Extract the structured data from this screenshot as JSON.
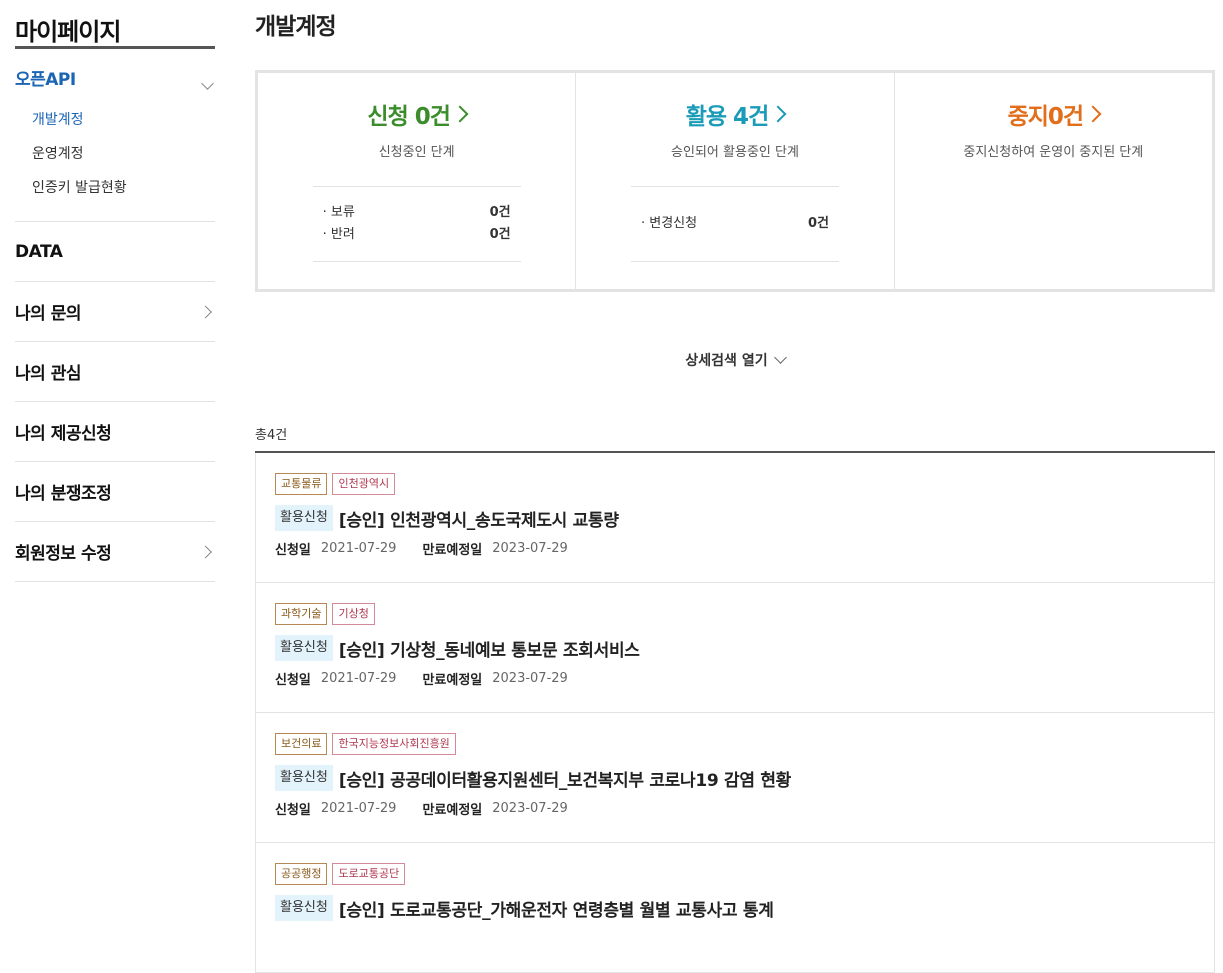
{
  "sidebar": {
    "title": "마이페이지",
    "open_menu": {
      "label": "오픈API",
      "sub_items": [
        "개발계정",
        "운영계정",
        "인증키 발급현황"
      ]
    },
    "items": [
      {
        "label": "DATA"
      },
      {
        "label": "나의 문의"
      },
      {
        "label": "나의 관심"
      },
      {
        "label": "나의 제공신청"
      },
      {
        "label": "나의 분쟁조정"
      },
      {
        "label": "회원정보 수정"
      }
    ]
  },
  "main": {
    "title": "개발계정",
    "summary": [
      {
        "title": "신청 0건",
        "desc": "신청중인 단계",
        "rows": [
          {
            "label": "· 보류",
            "value": "0건"
          },
          {
            "label": "· 반려",
            "value": "0건"
          }
        ]
      },
      {
        "title": "활용 4건",
        "desc": "승인되어 활용중인 단계",
        "rows": [
          {
            "label": "· 변경신청",
            "value": "0건"
          }
        ]
      },
      {
        "title": "중지0건",
        "desc": "중지신청하여 운영이 중지된 단계"
      }
    ],
    "detail_search_label": "상세검색 열기",
    "total_label": "총4건",
    "apply_date_label": "신청일",
    "expire_date_label": "만료예정일",
    "items": [
      {
        "category": "교통물류",
        "org": "인천광역시",
        "badge": "활용신청",
        "title": "[승인] 인천광역시_송도국제도시 교통량",
        "apply_date": "2021-07-29",
        "expire_date": "2023-07-29"
      },
      {
        "category": "과학기술",
        "org": "기상청",
        "badge": "활용신청",
        "title": "[승인] 기상청_동네예보 통보문 조회서비스",
        "apply_date": "2021-07-29",
        "expire_date": "2023-07-29"
      },
      {
        "category": "보건의료",
        "org": "한국지능정보사회진흥원",
        "badge": "활용신청",
        "title": "[승인] 공공데이터활용지원센터_보건복지부 코로나19 감염 현황",
        "apply_date": "2021-07-29",
        "expire_date": "2023-07-29"
      },
      {
        "category": "공공행정",
        "org": "도로교통공단",
        "badge": "활용신청",
        "title": "[승인] 도로교통공단_가해운전자 연령층별 월별 교통사고 통계",
        "apply_date": "",
        "expire_date": ""
      }
    ]
  }
}
